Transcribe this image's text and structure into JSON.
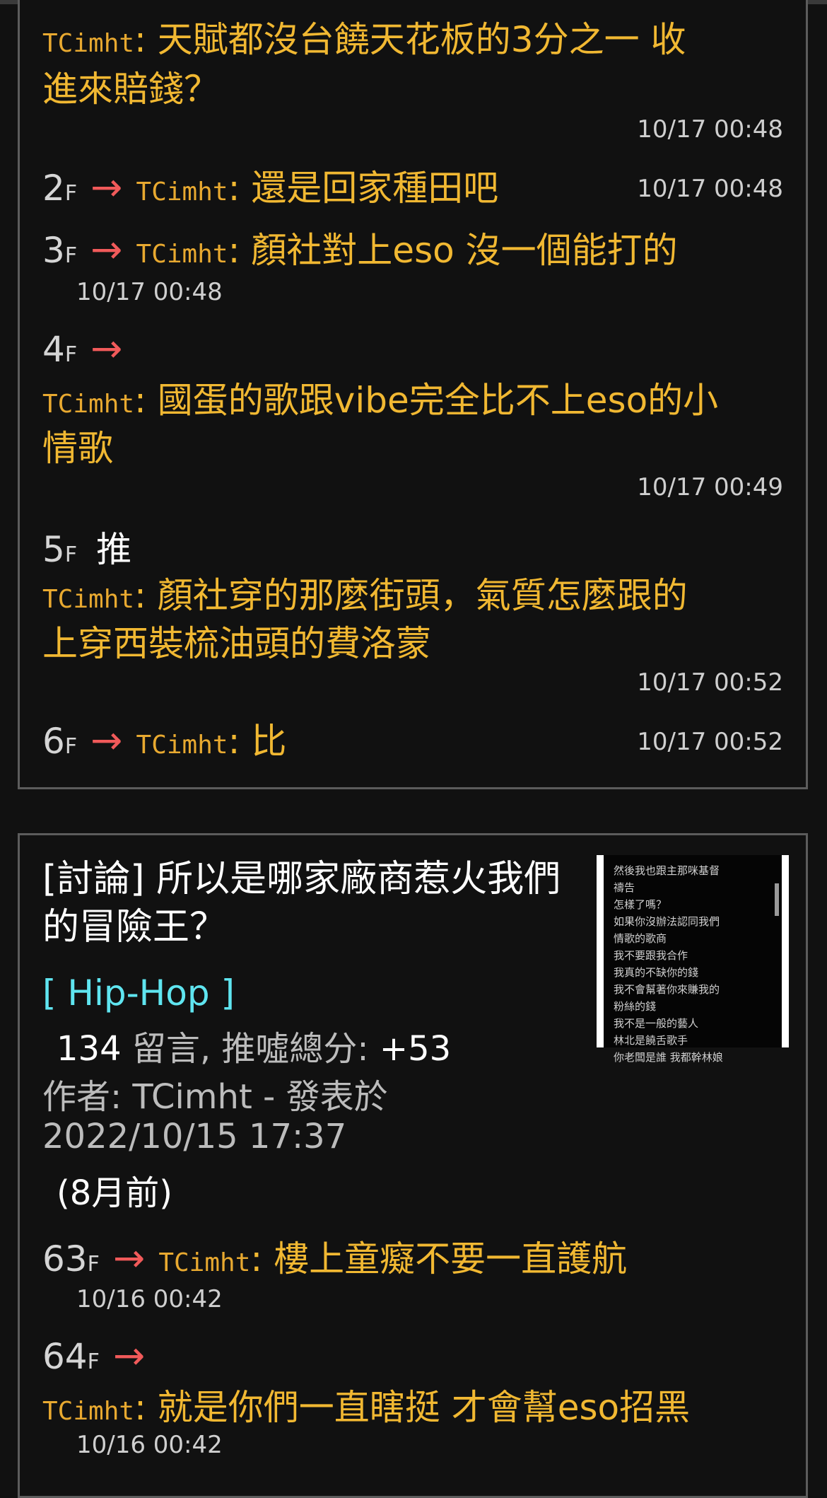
{
  "card1": {
    "c0": {
      "uid": "TCimht",
      "line1": "天賦都沒台饒天花板的3分之一 收",
      "line2": "進來賠錢？",
      "time": "10/17 00:48"
    },
    "c2": {
      "floor": "2",
      "f": "F",
      "arrow": "→",
      "uid": "TCimht",
      "text": "還是回家種田吧",
      "time": "10/17 00:48"
    },
    "c3": {
      "floor": "3",
      "f": "F",
      "arrow": "→",
      "uid": "TCimht",
      "text": "顏社對上eso 沒一個能打的",
      "time": "10/17 00:48"
    },
    "c4": {
      "floor": "4",
      "f": "F",
      "arrow": "→",
      "uid": "TCimht",
      "line1": "國蛋的歌跟vibe完全比不上eso的小",
      "line2": "情歌",
      "time": "10/17 00:49"
    },
    "c5": {
      "floor": "5",
      "f": "F",
      "push": "推",
      "uid": "TCimht",
      "line1": "顏社穿的那麼街頭，氣質怎麼跟的",
      "line2": "上穿西裝梳油頭的費洛蒙",
      "time": "10/17 00:52"
    },
    "c6": {
      "floor": "6",
      "f": "F",
      "arrow": "→",
      "uid": "TCimht",
      "text": "比",
      "time": "10/17 00:52"
    }
  },
  "card2": {
    "title": "[討論] 所以是哪家廠商惹火我們的冒險王？",
    "board": "[ Hip-Hop ]",
    "stats_count": "134",
    "stats_label": " 留言, 推噓總分: ",
    "stats_score": "+53",
    "author_line": "作者: TCimht - 發表於",
    "posted_at": "2022/10/15 17:37",
    "relative": "(8月前)",
    "thumb_lines": [
      "然後我也跟主那咪基督",
      "禱告",
      "怎樣了嗎？",
      "如果你沒辦法認同我們",
      "情歌的歌商",
      "我不要跟我合作",
      "我真的不缺你的錢",
      "我不會幫著你來賺我的",
      "粉絲的錢",
      "我不是一般的藝人",
      "林北是饒舌歌手",
      "你老闆是誰 我都幹林娘"
    ],
    "c63": {
      "floor": "63",
      "f": "F",
      "arrow": "→",
      "uid": "TCimht",
      "text": "樓上童癡不要一直護航",
      "time": "10/16 00:42"
    },
    "c64": {
      "floor": "64",
      "f": "F",
      "arrow": "→",
      "uid": "TCimht",
      "text": "就是你們一直瞎挺 才會幫eso招黑",
      "time": "10/16 00:42"
    }
  }
}
